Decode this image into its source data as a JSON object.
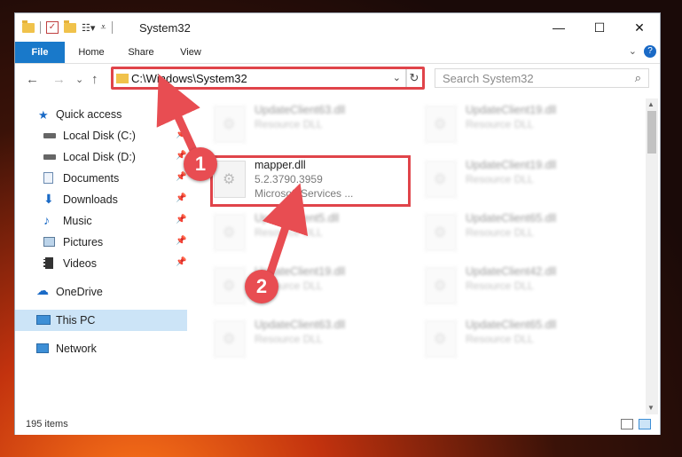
{
  "window": {
    "title": "System32",
    "controls": {
      "minimize": "—",
      "maximize": "☐",
      "close": "✕"
    }
  },
  "ribbon": {
    "tabs": [
      "File",
      "Home",
      "Share",
      "View"
    ],
    "help": "?",
    "collapse": "⌄"
  },
  "nav": {
    "back": "←",
    "forward": "→",
    "recent": "⌄",
    "up": "↑",
    "address": "C:\\Windows\\System32",
    "address_dropdown": "⌄",
    "refresh": "↻",
    "search_placeholder": "Search System32",
    "search_icon": "⌕"
  },
  "sidebar": {
    "items": [
      {
        "label": "Quick access",
        "icon": "star-icon",
        "pinned": false
      },
      {
        "label": "Local Disk (C:)",
        "icon": "drive-icon",
        "pinned": true
      },
      {
        "label": "Local Disk (D:)",
        "icon": "drive-icon",
        "pinned": true
      },
      {
        "label": "Documents",
        "icon": "documents-icon",
        "pinned": true
      },
      {
        "label": "Downloads",
        "icon": "download-icon",
        "pinned": true
      },
      {
        "label": "Music",
        "icon": "music-icon",
        "pinned": true
      },
      {
        "label": "Pictures",
        "icon": "pictures-icon",
        "pinned": true
      },
      {
        "label": "Videos",
        "icon": "videos-icon",
        "pinned": true
      },
      {
        "label": "OneDrive",
        "icon": "cloud-icon",
        "pinned": false
      },
      {
        "label": "This PC",
        "icon": "computer-icon",
        "pinned": false,
        "selected": true
      },
      {
        "label": "Network",
        "icon": "network-icon",
        "pinned": false
      }
    ]
  },
  "files": {
    "highlighted": {
      "name": "mapper.dll",
      "version": "5.2.3790.3959",
      "company": "Microsoft Services ..."
    },
    "left_column": [
      {
        "name": "UpdateClient63.dll",
        "type": "Resource DLL"
      },
      {
        "name": "UpdateClient5.dll",
        "type": "Resource DLL"
      },
      {
        "name": "UpdateClient19.dll",
        "type": "Resource DLL"
      },
      {
        "name": "UpdateClient63.dll",
        "type": "Resource DLL"
      }
    ],
    "right_column": [
      {
        "name": "UpdateClient19.dll",
        "type": "Resource DLL"
      },
      {
        "name": "UpdateClient19.dll",
        "type": "Resource DLL"
      },
      {
        "name": "UpdateClient65.dll",
        "type": "Resource DLL"
      },
      {
        "name": "UpdateClient42.dll",
        "type": "Resource DLL"
      },
      {
        "name": "UpdateClient65.dll",
        "type": "Resource DLL"
      }
    ]
  },
  "status": {
    "items": "195 items"
  },
  "annotations": {
    "step1": "1",
    "step2": "2",
    "color": "#e84d52"
  }
}
